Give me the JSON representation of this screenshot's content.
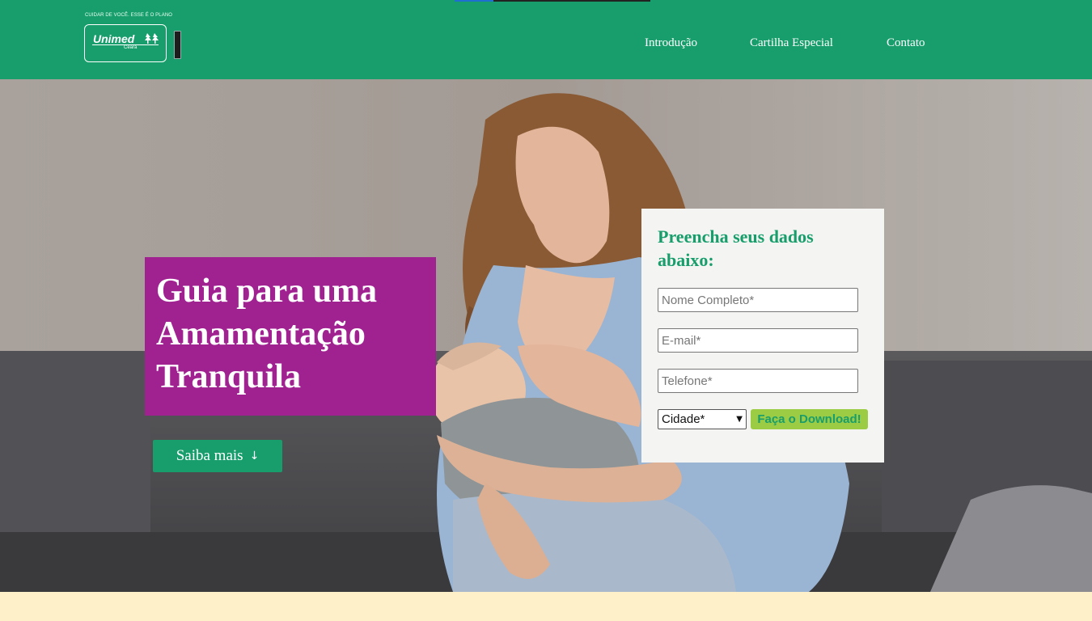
{
  "brand": {
    "tagline": "CUIDAR DE VOCÊ. ESSE É O PLANO",
    "name": "Unimed",
    "region": "Ceará",
    "primary_color": "#179e6c",
    "accent_color": "#a02291",
    "button_color": "#9ccc44"
  },
  "nav": {
    "items": [
      {
        "label": "Introdução"
      },
      {
        "label": "Cartilha Especial"
      },
      {
        "label": "Contato"
      }
    ]
  },
  "hero": {
    "title": "Guia para uma Amamentação Tranquila",
    "cta_label": "Saiba mais",
    "cta_icon": "arrow-down-icon"
  },
  "form": {
    "title": "Preencha seus dados abaixo:",
    "name_placeholder": "Nome Completo*",
    "email_placeholder": "E-mail*",
    "phone_placeholder": "Telefone*",
    "city_selected": "Cidade*",
    "submit_label": "Faça o Download!"
  }
}
